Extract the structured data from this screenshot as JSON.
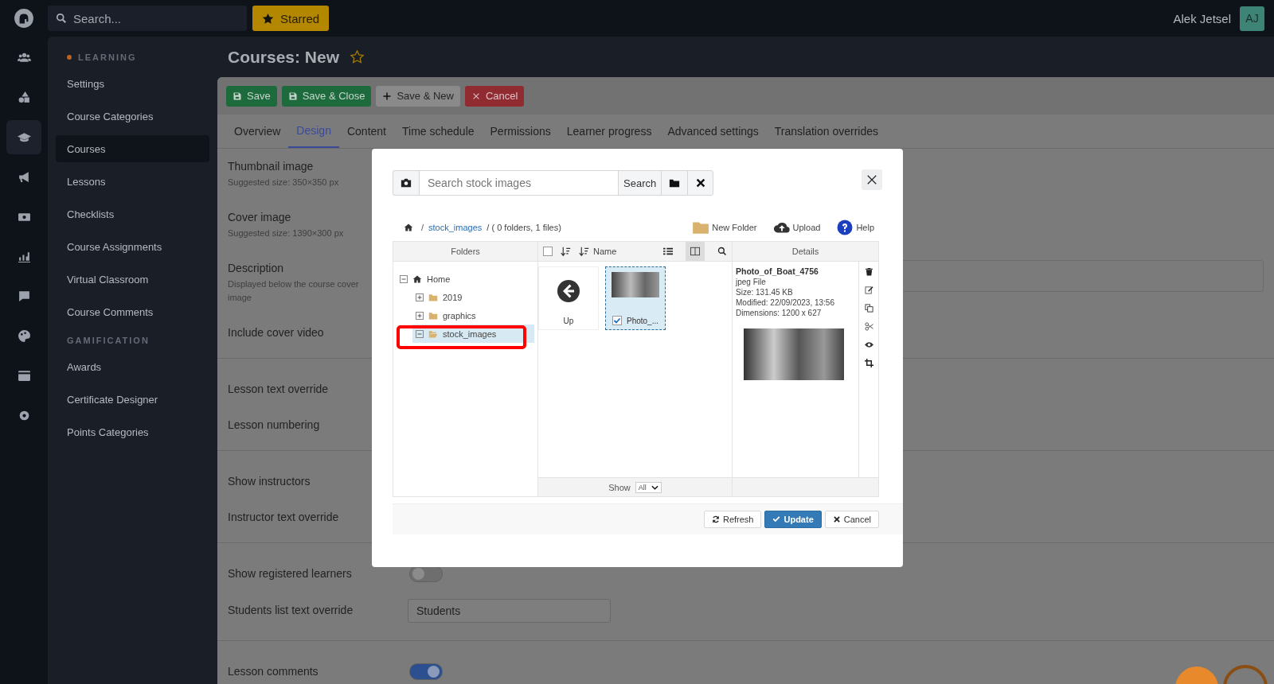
{
  "topbar": {
    "search_placeholder": "Search...",
    "starred_label": "Starred",
    "user_name": "Alek Jetsel",
    "user_initials": "AJ"
  },
  "rail": [
    {
      "selected": false
    },
    {
      "selected": false
    },
    {
      "selected": true
    },
    {
      "selected": false
    },
    {
      "selected": false
    },
    {
      "selected": false
    },
    {
      "selected": false
    },
    {
      "selected": false
    },
    {
      "selected": false
    },
    {
      "selected": false
    }
  ],
  "sidebar": {
    "sections": [
      {
        "title": "LEARNING",
        "current": true,
        "items": [
          {
            "label": "Settings",
            "selected": false
          },
          {
            "label": "Course Categories",
            "selected": false
          },
          {
            "label": "Courses",
            "selected": true
          },
          {
            "label": "Lessons",
            "selected": false
          },
          {
            "label": "Checklists",
            "selected": false
          },
          {
            "label": "Course Assignments",
            "selected": false
          },
          {
            "label": "Virtual Classroom",
            "selected": false
          },
          {
            "label": "Course Comments",
            "selected": false
          }
        ]
      },
      {
        "title": "GAMIFICATION",
        "current": false,
        "items": [
          {
            "label": "Awards",
            "selected": false
          },
          {
            "label": "Certificate Designer",
            "selected": false
          },
          {
            "label": "Points Categories",
            "selected": false
          }
        ]
      }
    ]
  },
  "page": {
    "title": "Courses: New",
    "starred": false
  },
  "toolbar": [
    {
      "label": "Save",
      "kind": "save"
    },
    {
      "label": "Save & Close",
      "kind": "save"
    },
    {
      "label": "Save & New",
      "kind": "new"
    },
    {
      "label": "Cancel",
      "kind": "cancel"
    }
  ],
  "tabs": [
    {
      "label": "Overview",
      "selected": false
    },
    {
      "label": "Design",
      "selected": true
    },
    {
      "label": "Content",
      "selected": false
    },
    {
      "label": "Time schedule",
      "selected": false
    },
    {
      "label": "Permissions",
      "selected": false
    },
    {
      "label": "Learner progress",
      "selected": false
    },
    {
      "label": "Advanced settings",
      "selected": false
    },
    {
      "label": "Translation overrides",
      "selected": false
    }
  ],
  "form": [
    [
      {
        "label": "Thumbnail image",
        "hint": "Suggested size: 350×350 px",
        "kind": "plain"
      },
      {
        "label": "Cover image",
        "hint": "Suggested size: 1390×300 px",
        "kind": "plain"
      },
      {
        "label": "Description",
        "hint": "Displayed below the course cover image",
        "kind": "textarea"
      },
      {
        "label": "Include cover video",
        "kind": "plain"
      }
    ],
    [
      {
        "label": "Lesson text override",
        "kind": "plain"
      },
      {
        "label": "Lesson numbering",
        "kind": "plain"
      }
    ],
    [
      {
        "label": "Show instructors",
        "kind": "plain"
      },
      {
        "label": "Instructor text override",
        "kind": "plain"
      }
    ],
    [
      {
        "label": "Show registered learners",
        "kind": "toggle",
        "on": false
      },
      {
        "label": "Students list text override",
        "kind": "text",
        "value": "Students"
      }
    ],
    [
      {
        "label": "Lesson comments",
        "kind": "toggle",
        "on": true
      }
    ]
  ],
  "file_manager": {
    "search_placeholder": "Search stock images",
    "search_button": "Search",
    "breadcrumb": {
      "separator": "/",
      "folder": "stock_images",
      "summary": "/ ( 0 folders, 1 files)"
    },
    "select_all": {
      "checked": false
    },
    "actions": [
      {
        "label": "New Folder",
        "kind": "folder"
      },
      {
        "label": "Upload",
        "kind": "upload"
      },
      {
        "label": "Help",
        "kind": "help"
      }
    ],
    "folders_heading": "Folders",
    "name_heading": "Name",
    "details_heading": "Details",
    "view_buttons": [
      {
        "selected": false
      },
      {
        "selected": true
      }
    ],
    "tree": [
      {
        "label": "Home",
        "expanded": true,
        "selected": false,
        "children": [
          {
            "label": "2019",
            "expanded": false,
            "selected": false
          },
          {
            "label": "graphics",
            "expanded": false,
            "selected": false
          },
          {
            "label": "stock_images",
            "expanded": true,
            "selected": true
          }
        ]
      }
    ],
    "files": [
      {
        "label": "Up",
        "kind": "up",
        "selected": false
      },
      {
        "label": "Photo_...",
        "kind": "image",
        "selected": true,
        "checked": true
      }
    ],
    "details": {
      "name": "Photo_of_Boat_4756",
      "lines": [
        "jpeg File",
        "Size: 131.45 KB",
        "Modified: 22/09/2023, 13:56",
        "Dimensions: 1200 x 627"
      ]
    },
    "show_label": "Show",
    "show_value": "All",
    "buttons": [
      {
        "label": "Refresh",
        "kind": "refresh"
      },
      {
        "label": "Update",
        "kind": "primary"
      },
      {
        "label": "Cancel",
        "kind": "cancel"
      }
    ]
  }
}
